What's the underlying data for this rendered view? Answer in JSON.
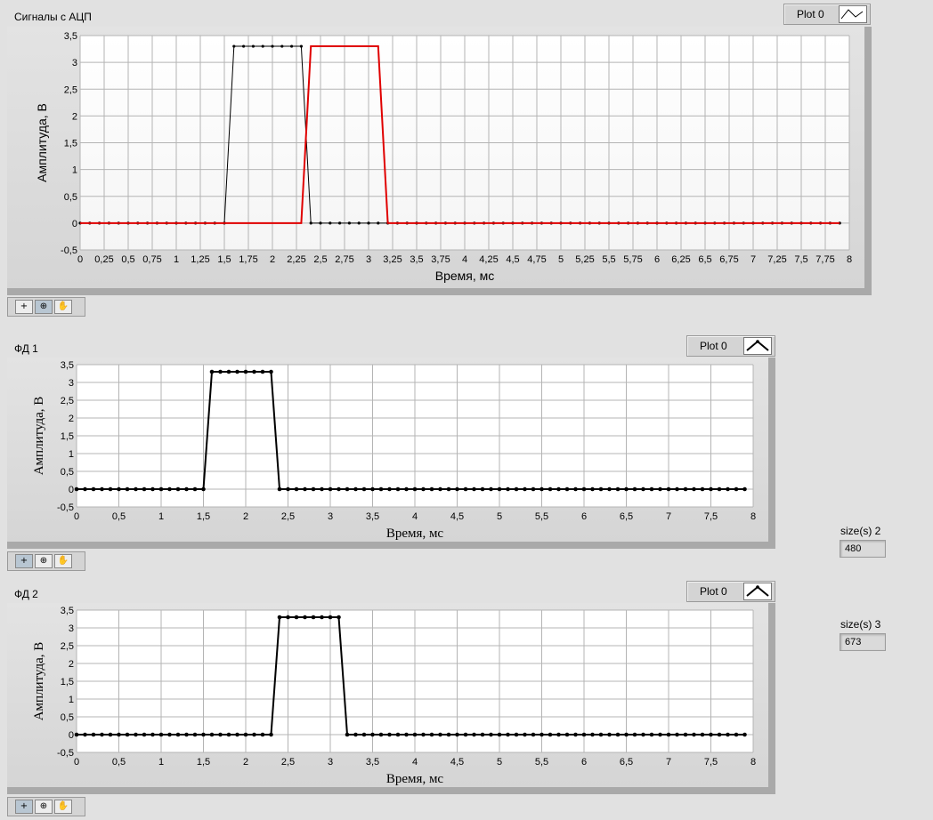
{
  "graphs": [
    {
      "id": "adc",
      "title": "Сигналы с АЦП",
      "legend_label": "Plot 0",
      "xlabel": "Время, мс",
      "ylabel": "Амплитуда, В",
      "xticks": [
        "0",
        "0,25",
        "0,5",
        "0,75",
        "1",
        "1,25",
        "1,5",
        "1,75",
        "2",
        "2,25",
        "2,5",
        "2,75",
        "3",
        "3,25",
        "3,5",
        "3,75",
        "4",
        "4,25",
        "4,5",
        "4,75",
        "5",
        "5,25",
        "5,5",
        "5,75",
        "6",
        "6,25",
        "6,5",
        "6,75",
        "7",
        "7,25",
        "7,5",
        "7,75",
        "8"
      ],
      "yticks": [
        "3,5",
        "3",
        "2,5",
        "2",
        "1,5",
        "1",
        "0,5",
        "0",
        "-0,5"
      ]
    },
    {
      "id": "fd1",
      "title": "ФД 1",
      "legend_label": "Plot 0",
      "xlabel": "Время, мс",
      "ylabel": "Амплитуда, В",
      "xticks": [
        "0",
        "0,5",
        "1",
        "1,5",
        "2",
        "2,5",
        "3",
        "3,5",
        "4",
        "4,5",
        "5",
        "5,5",
        "6",
        "6,5",
        "7",
        "7,5",
        "8"
      ],
      "yticks": [
        "3,5",
        "3",
        "2,5",
        "2",
        "1,5",
        "1",
        "0,5",
        "0",
        "-0,5"
      ]
    },
    {
      "id": "fd2",
      "title": "ФД 2",
      "legend_label": "Plot 0",
      "xlabel": "Время, мс",
      "ylabel": "Амплитуда, В",
      "xticks": [
        "0",
        "0,5",
        "1",
        "1,5",
        "2",
        "2,5",
        "3",
        "3,5",
        "4",
        "4,5",
        "5",
        "5,5",
        "6",
        "6,5",
        "7",
        "7,5",
        "8"
      ],
      "yticks": [
        "3,5",
        "3",
        "2,5",
        "2",
        "1,5",
        "1",
        "0,5",
        "0",
        "-0,5"
      ]
    }
  ],
  "indicators": [
    {
      "label": "size(s) 2",
      "value": "480"
    },
    {
      "label": "size(s) 3",
      "value": "673"
    }
  ],
  "colors": {
    "grid": "#b4b4b4",
    "trace_black": "#000000",
    "trace_red": "#e00000",
    "plot_bg_top": "#ffffff"
  },
  "chart_data": [
    {
      "type": "line",
      "title": "Сигналы с АЦП",
      "xlabel": "Время, мс",
      "ylabel": "Амплитуда, В",
      "xlim": [
        0,
        8
      ],
      "ylim": [
        -0.5,
        3.5
      ],
      "grid": true,
      "series": [
        {
          "name": "",
          "color": "#000000",
          "markers": true,
          "x": [
            0,
            0.1,
            0.2,
            0.3,
            0.4,
            0.5,
            0.6,
            0.7,
            0.8,
            0.9,
            1,
            1.1,
            1.2,
            1.3,
            1.4,
            1.5,
            1.6,
            1.7,
            1.8,
            1.9,
            2,
            2.1,
            2.2,
            2.3,
            2.4,
            2.5,
            2.6,
            2.7,
            2.8,
            2.9,
            3,
            3.1,
            3.2,
            3.3,
            3.4,
            3.5,
            3.6,
            3.7,
            3.8,
            3.9,
            4,
            4.1,
            4.2,
            4.3,
            4.4,
            4.5,
            4.6,
            4.7,
            4.8,
            4.9,
            5,
            5.1,
            5.2,
            5.3,
            5.4,
            5.5,
            5.6,
            5.7,
            5.8,
            5.9,
            6,
            6.1,
            6.2,
            6.3,
            6.4,
            6.5,
            6.6,
            6.7,
            6.8,
            6.9,
            7,
            7.1,
            7.2,
            7.3,
            7.4,
            7.5,
            7.6,
            7.7,
            7.8,
            7.9
          ],
          "y": [
            0,
            0,
            0,
            0,
            0,
            0,
            0,
            0,
            0,
            0,
            0,
            0,
            0,
            0,
            0,
            0,
            3.3,
            3.3,
            3.3,
            3.3,
            3.3,
            3.3,
            3.3,
            3.3,
            0,
            0,
            0,
            0,
            0,
            0,
            0,
            0,
            0,
            0,
            0,
            0,
            0,
            0,
            0,
            0,
            0,
            0,
            0,
            0,
            0,
            0,
            0,
            0,
            0,
            0,
            0,
            0,
            0,
            0,
            0,
            0,
            0,
            0,
            0,
            0,
            0,
            0,
            0,
            0,
            0,
            0,
            0,
            0,
            0,
            0,
            0,
            0,
            0,
            0,
            0,
            0,
            0,
            0,
            0,
            0
          ]
        },
        {
          "name": "",
          "color": "#e00000",
          "markers": false,
          "x": [
            0,
            2.3,
            2.4,
            3.1,
            3.2,
            7.9
          ],
          "y": [
            0,
            0,
            3.3,
            3.3,
            0,
            0
          ]
        }
      ]
    },
    {
      "type": "line",
      "title": "ФД 1",
      "xlabel": "Время, мс",
      "ylabel": "Амплитуда, В",
      "xlim": [
        0,
        8
      ],
      "ylim": [
        -0.5,
        3.5
      ],
      "grid": true,
      "series": [
        {
          "name": "",
          "color": "#000000",
          "markers": true,
          "x": [
            0,
            0.1,
            0.2,
            0.3,
            0.4,
            0.5,
            0.6,
            0.7,
            0.8,
            0.9,
            1,
            1.1,
            1.2,
            1.3,
            1.4,
            1.5,
            1.6,
            1.7,
            1.8,
            1.9,
            2,
            2.1,
            2.2,
            2.3,
            2.4,
            2.5,
            2.6,
            2.7,
            2.8,
            2.9,
            3,
            3.1,
            3.2,
            3.3,
            3.4,
            3.5,
            3.6,
            3.7,
            3.8,
            3.9,
            4,
            4.1,
            4.2,
            4.3,
            4.4,
            4.5,
            4.6,
            4.7,
            4.8,
            4.9,
            5,
            5.1,
            5.2,
            5.3,
            5.4,
            5.5,
            5.6,
            5.7,
            5.8,
            5.9,
            6,
            6.1,
            6.2,
            6.3,
            6.4,
            6.5,
            6.6,
            6.7,
            6.8,
            6.9,
            7,
            7.1,
            7.2,
            7.3,
            7.4,
            7.5,
            7.6,
            7.7,
            7.8,
            7.9
          ],
          "y": [
            0,
            0,
            0,
            0,
            0,
            0,
            0,
            0,
            0,
            0,
            0,
            0,
            0,
            0,
            0,
            0,
            3.3,
            3.3,
            3.3,
            3.3,
            3.3,
            3.3,
            3.3,
            3.3,
            0,
            0,
            0,
            0,
            0,
            0,
            0,
            0,
            0,
            0,
            0,
            0,
            0,
            0,
            0,
            0,
            0,
            0,
            0,
            0,
            0,
            0,
            0,
            0,
            0,
            0,
            0,
            0,
            0,
            0,
            0,
            0,
            0,
            0,
            0,
            0,
            0,
            0,
            0,
            0,
            0,
            0,
            0,
            0,
            0,
            0,
            0,
            0,
            0,
            0,
            0,
            0,
            0,
            0,
            0,
            0
          ]
        }
      ]
    },
    {
      "type": "line",
      "title": "ФД 2",
      "xlabel": "Время, мс",
      "ylabel": "Амплитуда, В",
      "xlim": [
        0,
        8
      ],
      "ylim": [
        -0.5,
        3.5
      ],
      "grid": true,
      "series": [
        {
          "name": "",
          "color": "#000000",
          "markers": true,
          "x": [
            0,
            0.1,
            0.2,
            0.3,
            0.4,
            0.5,
            0.6,
            0.7,
            0.8,
            0.9,
            1,
            1.1,
            1.2,
            1.3,
            1.4,
            1.5,
            1.6,
            1.7,
            1.8,
            1.9,
            2,
            2.1,
            2.2,
            2.3,
            2.4,
            2.5,
            2.6,
            2.7,
            2.8,
            2.9,
            3,
            3.1,
            3.2,
            3.3,
            3.4,
            3.5,
            3.6,
            3.7,
            3.8,
            3.9,
            4,
            4.1,
            4.2,
            4.3,
            4.4,
            4.5,
            4.6,
            4.7,
            4.8,
            4.9,
            5,
            5.1,
            5.2,
            5.3,
            5.4,
            5.5,
            5.6,
            5.7,
            5.8,
            5.9,
            6,
            6.1,
            6.2,
            6.3,
            6.4,
            6.5,
            6.6,
            6.7,
            6.8,
            6.9,
            7,
            7.1,
            7.2,
            7.3,
            7.4,
            7.5,
            7.6,
            7.7,
            7.8,
            7.9
          ],
          "y": [
            0,
            0,
            0,
            0,
            0,
            0,
            0,
            0,
            0,
            0,
            0,
            0,
            0,
            0,
            0,
            0,
            0,
            0,
            0,
            0,
            0,
            0,
            0,
            0,
            3.3,
            3.3,
            3.3,
            3.3,
            3.3,
            3.3,
            3.3,
            3.3,
            0,
            0,
            0,
            0,
            0,
            0,
            0,
            0,
            0,
            0,
            0,
            0,
            0,
            0,
            0,
            0,
            0,
            0,
            0,
            0,
            0,
            0,
            0,
            0,
            0,
            0,
            0,
            0,
            0,
            0,
            0,
            0,
            0,
            0,
            0,
            0,
            0,
            0,
            0,
            0,
            0,
            0,
            0,
            0,
            0,
            0,
            0,
            0
          ]
        }
      ]
    }
  ]
}
